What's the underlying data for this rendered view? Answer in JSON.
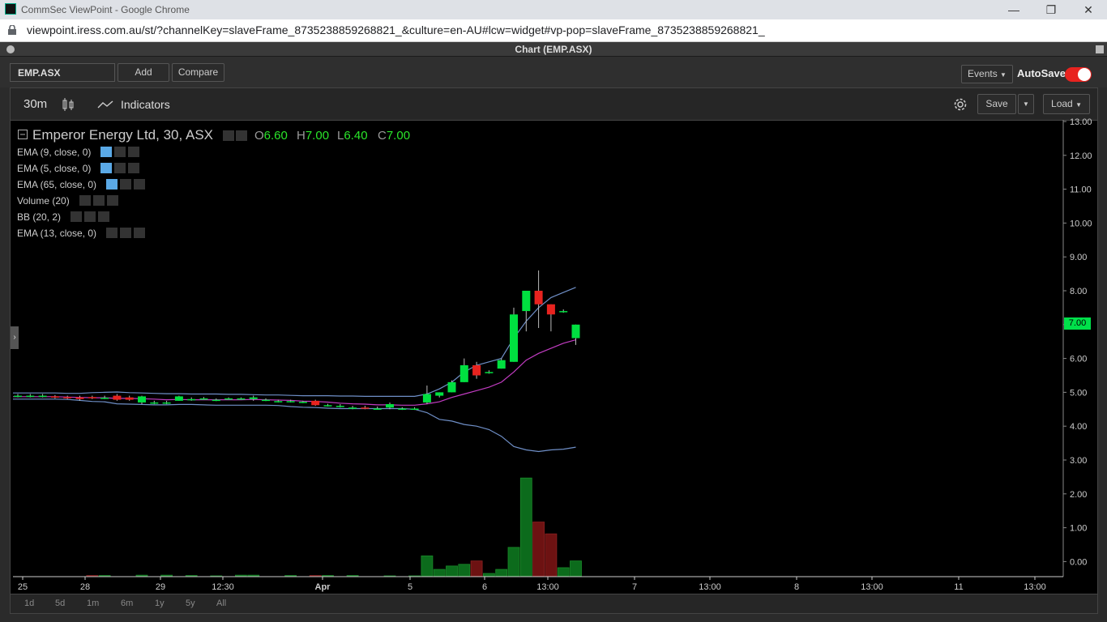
{
  "browser": {
    "window_title": "CommSec ViewPoint - Google Chrome",
    "url": "viewpoint.iress.com.au/st/?channelKey=slaveFrame_8735238859268821_&culture=en-AU#lcw=widget#vp-pop=slaveFrame_8735238859268821_",
    "minimize": "—",
    "restore": "❐",
    "close": "✕"
  },
  "panel": {
    "title": "Chart (EMP.ASX)"
  },
  "toolbar": {
    "symbol": "EMP.ASX",
    "add": "Add",
    "compare": "Compare",
    "events": "Events",
    "autosave": "AutoSave"
  },
  "chart_toolbar": {
    "interval": "30m",
    "indicators": "Indicators",
    "save": "Save",
    "load": "Load"
  },
  "legend": {
    "title": "Emperor Energy Ltd, 30, ASX",
    "o_label": "O",
    "o": "6.60",
    "h_label": "H",
    "h": "7.00",
    "l_label": "L",
    "l": "6.40",
    "c_label": "C",
    "c": "7.00"
  },
  "indicators": [
    {
      "label": "EMA (9, close, 0)",
      "active": true
    },
    {
      "label": "EMA (5, close, 0)",
      "active": true
    },
    {
      "label": "EMA (65, close, 0)",
      "active": true
    },
    {
      "label": "Volume (20)",
      "active": false
    },
    {
      "label": "BB (20, 2)",
      "active": false
    },
    {
      "label": "EMA (13, close, 0)",
      "active": false
    }
  ],
  "periods": [
    "1d",
    "5d",
    "1m",
    "6m",
    "1y",
    "5y",
    "All"
  ],
  "colors": {
    "up": "#00e040",
    "down": "#e8231f",
    "vol_up": "#0c6b1c",
    "vol_down": "#6d1212",
    "bb": "#6f8fc7",
    "ema": "#c23cc2"
  },
  "chart_data": {
    "type": "candlestick",
    "title": "Emperor Energy Ltd, 30, ASX",
    "y_ticks": [
      "13.00",
      "12.00",
      "11.00",
      "10.00",
      "9.00",
      "8.00",
      "7.00",
      "6.00",
      "5.00",
      "4.00",
      "3.00",
      "2.00",
      "1.00",
      "0.00"
    ],
    "ylim": [
      0,
      13
    ],
    "x_ticks": [
      "25",
      "28",
      "29",
      "12:30",
      "Apr",
      "5",
      "6",
      "13:00",
      "7",
      "13:00",
      "8",
      "13:00",
      "11",
      "13:00"
    ],
    "last_price": "7.00",
    "candles": [
      {
        "o": 4.9,
        "h": 4.95,
        "l": 4.85,
        "c": 4.9
      },
      {
        "o": 4.9,
        "h": 4.95,
        "l": 4.85,
        "c": 4.9
      },
      {
        "o": 4.9,
        "h": 4.95,
        "l": 4.85,
        "c": 4.9
      },
      {
        "o": 4.88,
        "h": 4.92,
        "l": 4.82,
        "c": 4.86
      },
      {
        "o": 4.86,
        "h": 4.9,
        "l": 4.8,
        "c": 4.84
      },
      {
        "o": 4.85,
        "h": 4.9,
        "l": 4.75,
        "c": 4.8
      },
      {
        "o": 4.86,
        "h": 4.9,
        "l": 4.8,
        "c": 4.84
      },
      {
        "o": 4.84,
        "h": 4.9,
        "l": 4.8,
        "c": 4.84
      },
      {
        "o": 4.9,
        "h": 4.95,
        "l": 4.75,
        "c": 4.78
      },
      {
        "o": 4.85,
        "h": 4.9,
        "l": 4.75,
        "c": 4.78
      },
      {
        "o": 4.7,
        "h": 4.9,
        "l": 4.65,
        "c": 4.88
      },
      {
        "o": 4.7,
        "h": 4.75,
        "l": 4.65,
        "c": 4.7
      },
      {
        "o": 4.7,
        "h": 4.75,
        "l": 4.65,
        "c": 4.7
      },
      {
        "o": 4.75,
        "h": 4.9,
        "l": 4.75,
        "c": 4.88
      },
      {
        "o": 4.8,
        "h": 4.85,
        "l": 4.75,
        "c": 4.8
      },
      {
        "o": 4.82,
        "h": 4.86,
        "l": 4.78,
        "c": 4.82
      },
      {
        "o": 4.78,
        "h": 4.82,
        "l": 4.74,
        "c": 4.78
      },
      {
        "o": 4.82,
        "h": 4.85,
        "l": 4.78,
        "c": 4.82
      },
      {
        "o": 4.82,
        "h": 4.85,
        "l": 4.78,
        "c": 4.82
      },
      {
        "o": 4.8,
        "h": 4.9,
        "l": 4.75,
        "c": 4.85
      },
      {
        "o": 4.78,
        "h": 4.82,
        "l": 4.74,
        "c": 4.78
      },
      {
        "o": 4.74,
        "h": 4.78,
        "l": 4.7,
        "c": 4.74
      },
      {
        "o": 4.72,
        "h": 4.78,
        "l": 4.7,
        "c": 4.74
      },
      {
        "o": 4.72,
        "h": 4.75,
        "l": 4.68,
        "c": 4.72
      },
      {
        "o": 4.75,
        "h": 4.78,
        "l": 4.6,
        "c": 4.62
      },
      {
        "o": 4.62,
        "h": 4.66,
        "l": 4.58,
        "c": 4.62
      },
      {
        "o": 4.6,
        "h": 4.65,
        "l": 4.55,
        "c": 4.6
      },
      {
        "o": 4.55,
        "h": 4.6,
        "l": 4.5,
        "c": 4.55
      },
      {
        "o": 4.55,
        "h": 4.6,
        "l": 4.5,
        "c": 4.52
      },
      {
        "o": 4.52,
        "h": 4.58,
        "l": 4.5,
        "c": 4.52
      },
      {
        "o": 4.55,
        "h": 4.7,
        "l": 4.5,
        "c": 4.65
      },
      {
        "o": 4.52,
        "h": 4.56,
        "l": 4.48,
        "c": 4.52
      },
      {
        "o": 4.52,
        "h": 4.56,
        "l": 4.48,
        "c": 4.52
      },
      {
        "o": 4.7,
        "h": 5.2,
        "l": 4.65,
        "c": 4.95
      },
      {
        "o": 4.9,
        "h": 5.0,
        "l": 4.85,
        "c": 5.0
      },
      {
        "o": 5.0,
        "h": 5.35,
        "l": 5.0,
        "c": 5.3
      },
      {
        "o": 5.3,
        "h": 6.0,
        "l": 5.3,
        "c": 5.8
      },
      {
        "o": 5.8,
        "h": 5.9,
        "l": 5.4,
        "c": 5.5
      },
      {
        "o": 5.6,
        "h": 5.65,
        "l": 5.55,
        "c": 5.6
      },
      {
        "o": 5.7,
        "h": 6.0,
        "l": 5.7,
        "c": 5.95
      },
      {
        "o": 5.9,
        "h": 7.5,
        "l": 5.9,
        "c": 7.3
      },
      {
        "o": 7.4,
        "h": 8.0,
        "l": 6.8,
        "c": 8.0
      },
      {
        "o": 8.0,
        "h": 8.6,
        "l": 6.9,
        "c": 7.6
      },
      {
        "o": 7.6,
        "h": 7.6,
        "l": 6.8,
        "c": 7.3
      },
      {
        "o": 7.4,
        "h": 7.45,
        "l": 7.35,
        "c": 7.4
      },
      {
        "o": 6.6,
        "h": 7.0,
        "l": 6.4,
        "c": 7.0
      }
    ],
    "volume": [
      0,
      0,
      0,
      0,
      0,
      0,
      0.02,
      0.02,
      0,
      0,
      0.03,
      0,
      0.03,
      0,
      0.02,
      0,
      0.01,
      0,
      0.03,
      0.03,
      0,
      0,
      0.02,
      0,
      0.02,
      0.02,
      0,
      0.02,
      0,
      0,
      0.01,
      0,
      0.01,
      0.6,
      0.2,
      0.3,
      0.35,
      0.45,
      0.08,
      0.2,
      0.85,
      2.9,
      1.6,
      1.25,
      0.25,
      0.45
    ],
    "bb_upper": [
      4.98,
      4.98,
      4.98,
      4.98,
      4.97,
      4.97,
      4.99,
      5.0,
      5.01,
      4.99,
      4.98,
      4.97,
      4.96,
      4.96,
      4.95,
      4.95,
      4.95,
      4.94,
      4.94,
      4.93,
      4.92,
      4.92,
      4.91,
      4.9,
      4.9,
      4.9,
      4.89,
      4.89,
      4.88,
      4.88,
      4.88,
      4.88,
      4.88,
      4.95,
      5.1,
      5.3,
      5.6,
      5.8,
      5.9,
      6.0,
      6.6,
      7.1,
      7.5,
      7.8,
      7.95,
      8.1
    ],
    "bb_lower": [
      4.8,
      4.8,
      4.8,
      4.8,
      4.79,
      4.76,
      4.73,
      4.72,
      4.66,
      4.65,
      4.64,
      4.63,
      4.63,
      4.64,
      4.64,
      4.63,
      4.62,
      4.62,
      4.62,
      4.62,
      4.62,
      4.61,
      4.58,
      4.56,
      4.55,
      4.53,
      4.52,
      4.52,
      4.52,
      4.52,
      4.52,
      4.52,
      4.5,
      4.4,
      4.2,
      4.15,
      4.05,
      4.0,
      3.9,
      3.7,
      3.4,
      3.3,
      3.25,
      3.3,
      3.32,
      3.38
    ],
    "ema": [
      4.87,
      4.87,
      4.87,
      4.87,
      4.86,
      4.85,
      4.84,
      4.84,
      4.82,
      4.82,
      4.81,
      4.8,
      4.78,
      4.79,
      4.78,
      4.78,
      4.78,
      4.78,
      4.78,
      4.79,
      4.78,
      4.77,
      4.76,
      4.74,
      4.73,
      4.71,
      4.68,
      4.66,
      4.65,
      4.63,
      4.63,
      4.62,
      4.62,
      4.66,
      4.72,
      4.85,
      4.95,
      5.05,
      5.15,
      5.3,
      5.6,
      5.95,
      6.15,
      6.3,
      6.45,
      6.55
    ]
  }
}
